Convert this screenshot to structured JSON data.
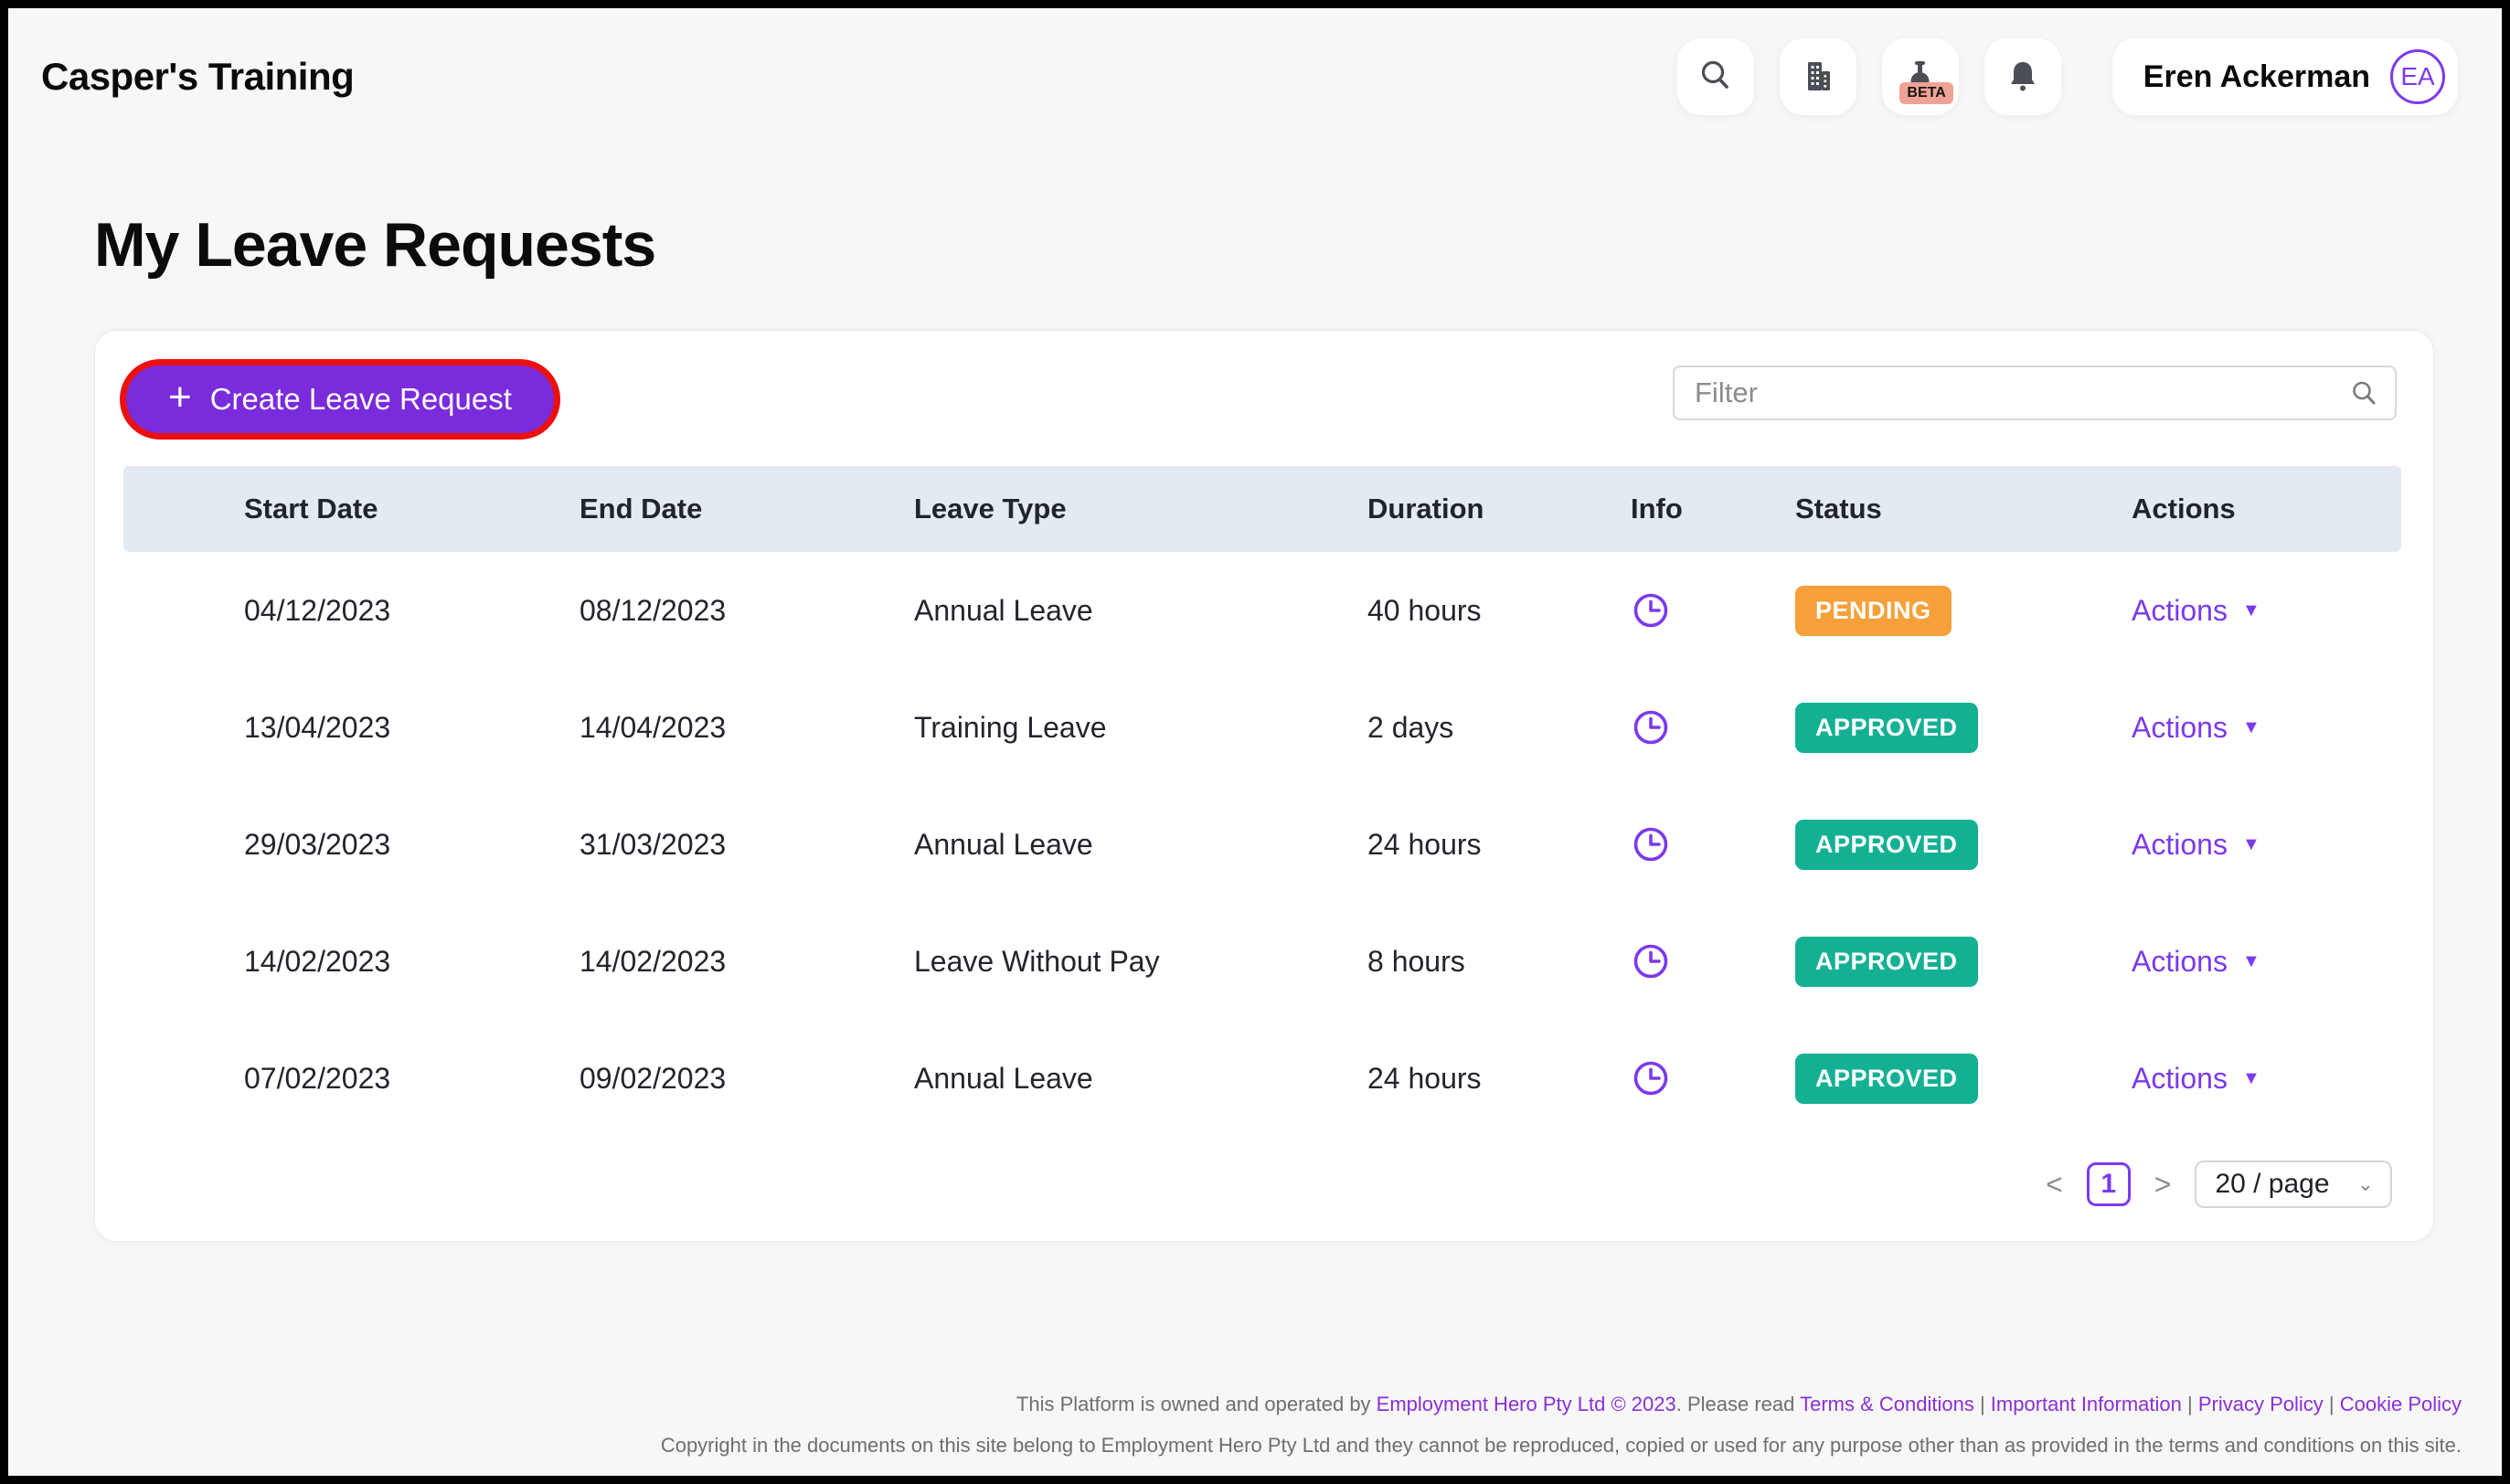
{
  "topbar": {
    "brand": "Casper's Training",
    "beta_badge": "BETA",
    "user": {
      "name": "Eren Ackerman",
      "initials": "EA"
    }
  },
  "page": {
    "title": "My Leave Requests"
  },
  "panel": {
    "create_button_label": "Create Leave Request",
    "create_button_plus": "+",
    "filter_placeholder": "Filter",
    "table": {
      "columns": [
        "Start Date",
        "End Date",
        "Leave Type",
        "Duration",
        "Info",
        "Status",
        "Actions"
      ],
      "rows": [
        {
          "start_date": "04/12/2023",
          "end_date": "08/12/2023",
          "leave_type": "Annual Leave",
          "duration": "40 hours",
          "status": "PENDING",
          "status_color": "#F5A03B",
          "actions_label": "Actions"
        },
        {
          "start_date": "13/04/2023",
          "end_date": "14/04/2023",
          "leave_type": "Training Leave",
          "duration": "2 days",
          "status": "APPROVED",
          "status_color": "#14B094",
          "actions_label": "Actions"
        },
        {
          "start_date": "29/03/2023",
          "end_date": "31/03/2023",
          "leave_type": "Annual Leave",
          "duration": "24 hours",
          "status": "APPROVED",
          "status_color": "#14B094",
          "actions_label": "Actions"
        },
        {
          "start_date": "14/02/2023",
          "end_date": "14/02/2023",
          "leave_type": "Leave Without Pay",
          "duration": "8 hours",
          "status": "APPROVED",
          "status_color": "#14B094",
          "actions_label": "Actions"
        },
        {
          "start_date": "07/02/2023",
          "end_date": "09/02/2023",
          "leave_type": "Annual Leave",
          "duration": "24 hours",
          "status": "APPROVED",
          "status_color": "#14B094",
          "actions_label": "Actions"
        }
      ]
    },
    "pagination": {
      "prev": "<",
      "current_page": "1",
      "next": ">",
      "page_size": "20 / page"
    }
  },
  "footer": {
    "line1": {
      "prefix": "This Platform is owned and operated by ",
      "company_link": "Employment Hero Pty Ltd © 2023",
      "middle": ". Please read ",
      "links": [
        "Terms & Conditions",
        "Important Information",
        "Privacy Policy",
        "Cookie Policy"
      ],
      "separator": " | "
    },
    "line2": "Copyright in the documents on this site belong to Employment Hero Pty Ltd and they cannot be reproduced, copied or used for any purpose other than as provided in the terms and conditions on this site."
  },
  "colors": {
    "primary_purple": "#7A2BDB",
    "link_purple": "#7C3AED",
    "pending_orange": "#F5A03B",
    "approved_teal": "#14B094",
    "highlight_red": "#EB1010",
    "header_row_bg": "#E4EAF1"
  }
}
